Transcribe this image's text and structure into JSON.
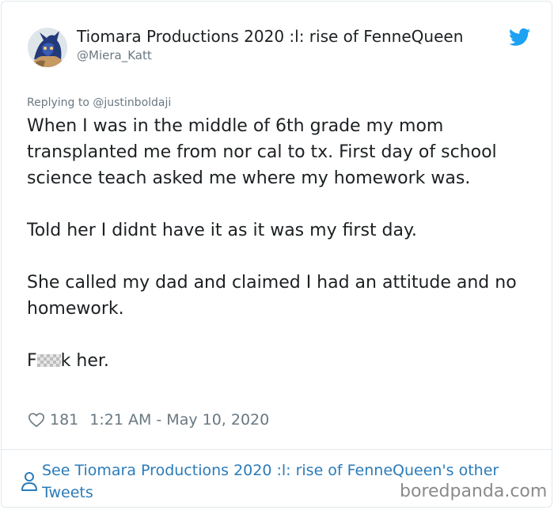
{
  "tweet": {
    "author": {
      "display_name": "Tiomara Productions 2020 :l: rise of FenneQueen",
      "handle": "@Miera_Katt",
      "avatar_icon": "avatar-image"
    },
    "platform_icon": "twitter-bird-icon",
    "brand_color": "#1da1f2",
    "replying_to": "Replying to @justinboldaji",
    "paragraphs": [
      "When I was in the middle of 6th grade my mom transplanted me from nor cal to tx. First day of school science teach asked me where my homework was.",
      "Told her I didnt have it as it was my first day.",
      "She called my dad and claimed I had an attitude and no homework."
    ],
    "final_line": {
      "before": "F",
      "after": "k her."
    },
    "likes": "181",
    "timestamp": "1:21 AM - May 10, 2020",
    "see_more": "See Tiomara Productions 2020 :l: rise of FenneQueen's other Tweets",
    "link_color": "#2b7bb9"
  },
  "watermark": "boredpanda.com"
}
